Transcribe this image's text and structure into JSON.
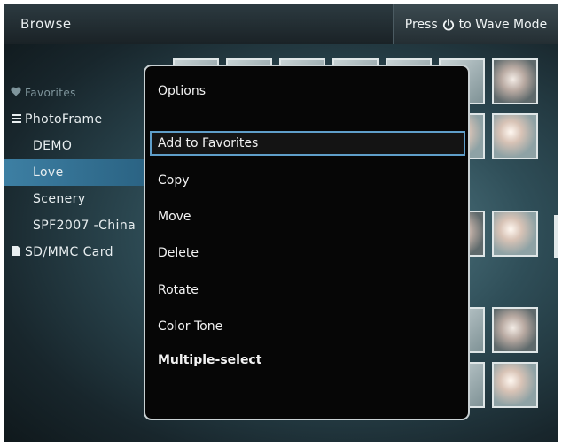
{
  "topbar": {
    "title": "Browse",
    "hint_prefix": "Press",
    "hint_icon": "power-icon",
    "hint_suffix": "to Wave Mode"
  },
  "sidebar": {
    "items": [
      {
        "label": "Favorites",
        "icon": "heart-icon",
        "level": "top",
        "dim": true
      },
      {
        "label": "PhotoFrame",
        "icon": "list-icon",
        "level": "top"
      },
      {
        "label": "DEMO",
        "level": "sub"
      },
      {
        "label": "Love",
        "level": "sub",
        "selected": true
      },
      {
        "label": "Scenery",
        "level": "sub"
      },
      {
        "label": "SPF2007 -China",
        "level": "sub"
      },
      {
        "label": "SD/MMC Card",
        "icon": "card-icon",
        "level": "top"
      }
    ]
  },
  "options_menu": {
    "title": "Options",
    "items": [
      {
        "label": "Add to Favorites",
        "highlighted": true
      },
      {
        "label": "Copy"
      },
      {
        "label": "Move"
      },
      {
        "label": "Delete"
      },
      {
        "label": "Rotate"
      },
      {
        "label": "Color Tone"
      },
      {
        "label": "Multiple-select",
        "bold": true
      }
    ]
  },
  "colors": {
    "selection": "#3d7fa3",
    "menu_bg": "#060606",
    "menu_border": "#c9d1d3",
    "highlight_border": "#5f9ec9"
  }
}
